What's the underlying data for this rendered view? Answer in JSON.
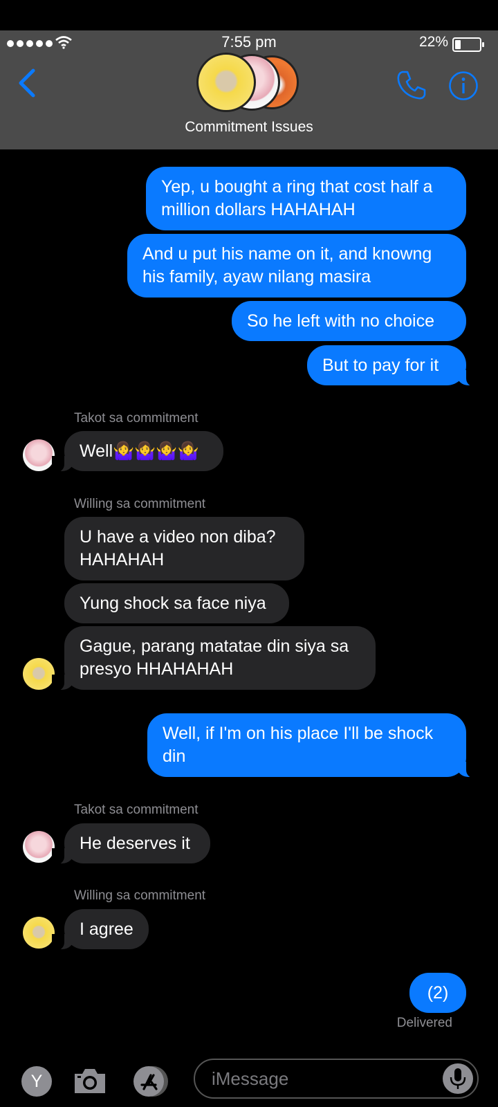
{
  "status_bar": {
    "time": "7:55 pm",
    "battery_percent": "22%",
    "battery_level": 0.22
  },
  "header": {
    "group_name": "Commitment Issues"
  },
  "colors": {
    "outgoing_bubble": "#0a7aff",
    "incoming_bubble": "#262628",
    "accent": "#0a7aff",
    "header_bg": "#4b4b4b"
  },
  "messages": [
    {
      "direction": "out",
      "text": "Yep, u bought a ring that cost half a\nmillion dollars HAHAHAH"
    },
    {
      "direction": "out",
      "text": "And u put his name on it, and knowng\nhis family, ayaw nilang masira"
    },
    {
      "direction": "out",
      "text": "So he left with no choice"
    },
    {
      "direction": "out",
      "text": "But to pay for it"
    },
    {
      "direction": "in",
      "sender": "Takot sa commitment",
      "text": "Well🤷‍♀️🤷‍♀️🤷‍♀️🤷‍♀️"
    },
    {
      "direction": "in",
      "sender": "Willing sa commitment",
      "text": "U have a video non diba?\nHAHAHAH"
    },
    {
      "direction": "in",
      "text": "Yung shock sa face niya"
    },
    {
      "direction": "in",
      "text": "Gague, parang matatae din siya sa\npresyo HHAHAHAH"
    },
    {
      "direction": "out",
      "text": "Well, if I'm on his place I'll be shock\ndin"
    },
    {
      "direction": "in",
      "sender": "Takot sa commitment",
      "text": "He deserves it"
    },
    {
      "direction": "in",
      "sender": "Willing sa commitment",
      "text": "I agree"
    },
    {
      "direction": "out",
      "text": "(2)"
    }
  ],
  "delivered_label": "Delivered",
  "input_bar": {
    "apps_button_label": "Y",
    "placeholder": "iMessage"
  },
  "icons": {
    "back": "chevron-left-icon",
    "call": "phone-icon",
    "info": "info-icon",
    "camera": "camera-icon",
    "appstore": "appstore-icon",
    "mic": "microphone-icon"
  }
}
